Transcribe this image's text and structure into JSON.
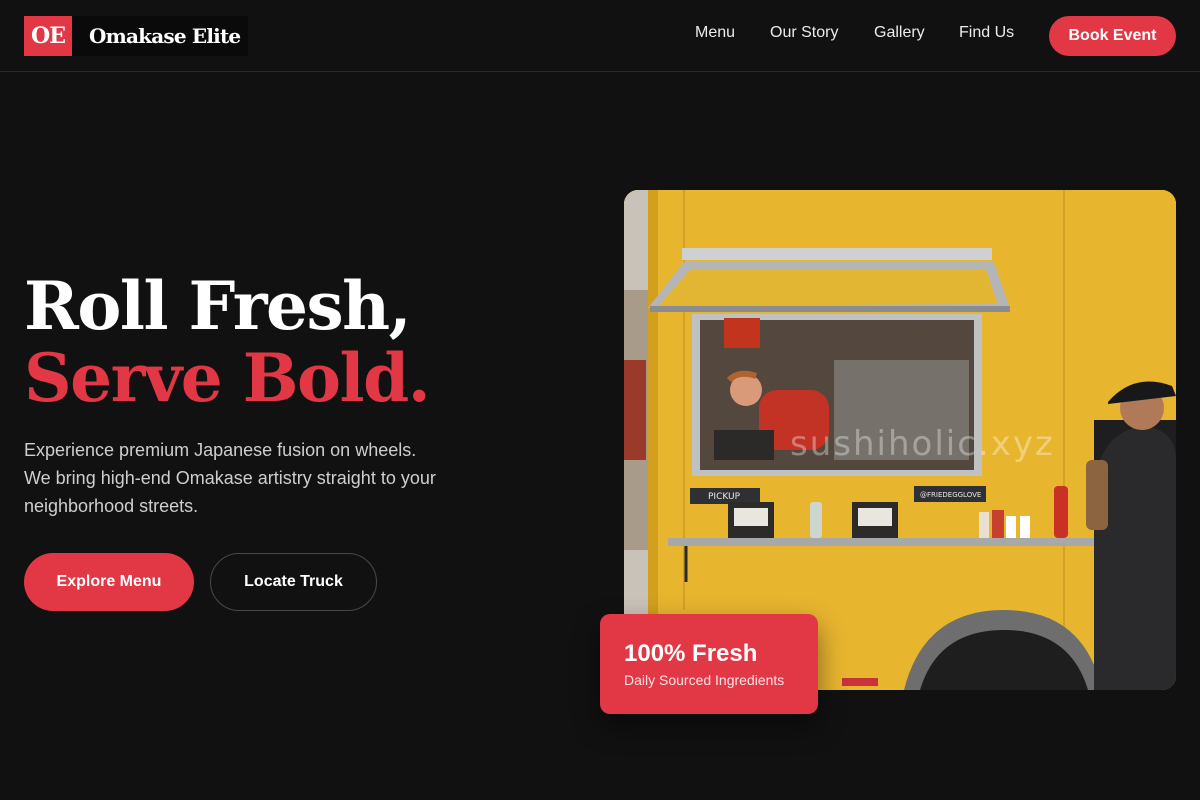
{
  "brand": {
    "badge": "OE",
    "name": "Omakase Elite",
    "accent_color": "#e23744",
    "background_color": "#121112"
  },
  "nav": {
    "links": [
      "Menu",
      "Our Story",
      "Gallery",
      "Find Us"
    ],
    "cta_label": "Book Event"
  },
  "hero": {
    "title_line1": "Roll Fresh,",
    "title_line2": "Serve Bold.",
    "description_lines": [
      "Experience premium Japanese fusion on wheels.",
      "We bring high-end Omakase artistry straight to your",
      "neighborhood streets."
    ],
    "primary_button": "Explore Menu",
    "secondary_button": "Locate Truck"
  },
  "image": {
    "watermark": "sushiholic.xyz",
    "sign_left": "PICKUP",
    "sign_right": "@FRIEDEGGLOVE"
  },
  "badge_card": {
    "title": "100% Fresh",
    "subtitle": "Daily Sourced Ingredients"
  }
}
